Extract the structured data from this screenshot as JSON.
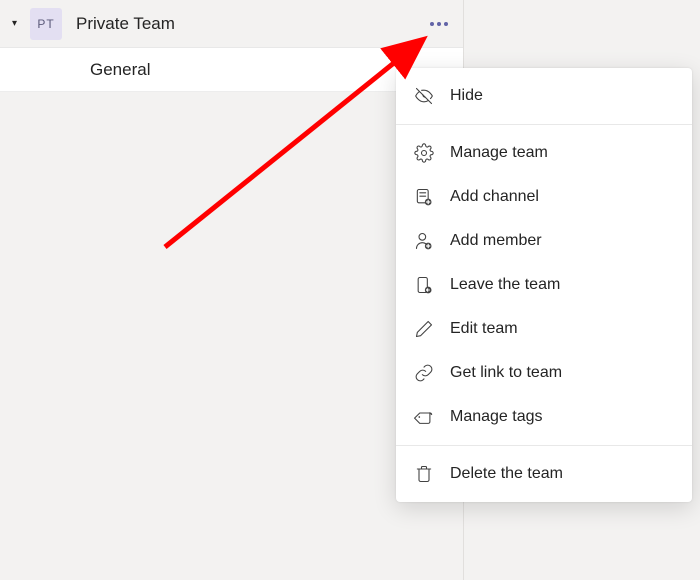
{
  "team": {
    "avatar_initials": "PT",
    "name": "Private Team",
    "channels": [
      {
        "name": "General"
      }
    ]
  },
  "menu": {
    "hide": "Hide",
    "manage_team": "Manage team",
    "add_channel": "Add channel",
    "add_member": "Add member",
    "leave_team": "Leave the team",
    "edit_team": "Edit team",
    "get_link": "Get link to team",
    "manage_tags": "Manage tags",
    "delete_team": "Delete the team"
  },
  "colors": {
    "accent": "#6264a7",
    "arrow": "#ff0000"
  }
}
